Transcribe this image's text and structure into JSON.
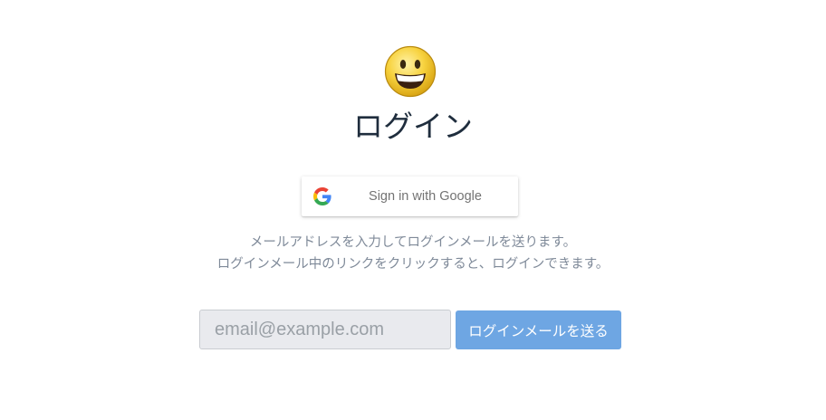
{
  "login": {
    "logo_icon": "smiley-face-icon",
    "title": "ログイン",
    "google_button": {
      "icon": "google-g-icon",
      "label": "Sign in with Google"
    },
    "description_lines": [
      "メールアドレスを入力してログインメールを送ります。",
      "ログインメール中のリンクをクリックすると、ログインできます。"
    ],
    "email_input": {
      "value": "",
      "placeholder": "email@example.com"
    },
    "send_button_label": "ログインメールを送る"
  },
  "colors": {
    "title": "#1f2d3d",
    "description": "#7f8a99",
    "send_button_bg": "#6ea6e3",
    "input_bg": "#e9eaee"
  }
}
